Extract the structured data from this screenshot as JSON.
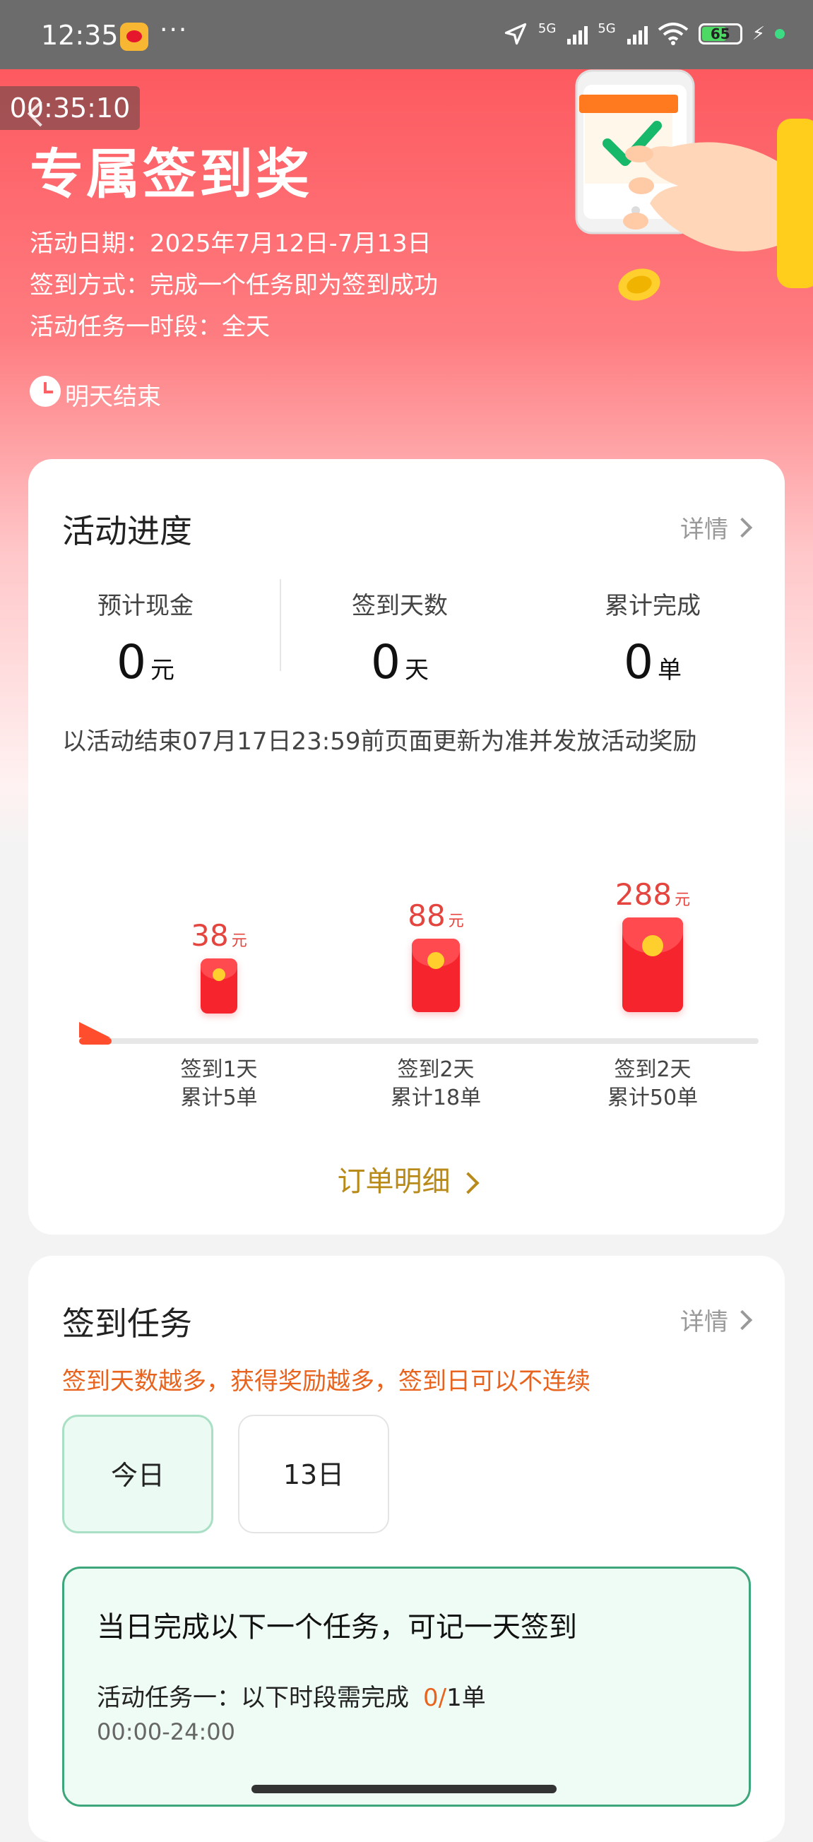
{
  "status_bar": {
    "time": "12:35",
    "more": "···",
    "signal1_label": "5G",
    "signal2_label": "5G",
    "battery_level": "65",
    "battery_percent": 65,
    "colors": {
      "background": "#6c6c6c",
      "battery_fill": "#4cd964"
    }
  },
  "timer": "00:35:10",
  "hero": {
    "title": "专属签到奖",
    "date_line": "活动日期：2025年7月12日-7月13日",
    "method_line": "签到方式：完成一个任务即为签到成功",
    "slot_line": "活动任务一时段：全天",
    "ends_label": "明天结束",
    "colors": {
      "gradient_top": "#fd5a60",
      "gradient_bottom": "#fff2f2"
    }
  },
  "progress_card": {
    "title": "活动进度",
    "detail_label": "详情",
    "stats": [
      {
        "label": "预计现金",
        "value": "0",
        "unit": "元"
      },
      {
        "label": "签到天数",
        "value": "0",
        "unit": "天"
      },
      {
        "label": "累计完成",
        "value": "0",
        "unit": "单"
      }
    ],
    "notice": "以活动结束07月17日23:59前页面更新为准并发放活动奖励",
    "milestones": [
      {
        "amount": "38",
        "unit": "元",
        "caption_line1": "签到1天",
        "caption_line2": "累计5单"
      },
      {
        "amount": "88",
        "unit": "元",
        "caption_line1": "签到2天",
        "caption_line2": "累计18单"
      },
      {
        "amount": "288",
        "unit": "元",
        "caption_line1": "签到2天",
        "caption_line2": "累计50单"
      }
    ],
    "order_link": "订单明细",
    "colors": {
      "amount": "#e5453f",
      "envelope": "#f5242d",
      "seal": "#ffcf2e",
      "order_link": "#b88a1a"
    }
  },
  "task_card": {
    "title": "签到任务",
    "detail_label": "详情",
    "subtitle": "签到天数越多，获得奖励越多，签到日可以不连续",
    "tabs": [
      {
        "label": "今日",
        "active": true
      },
      {
        "label": "13日",
        "active": false
      }
    ],
    "task_head": "当日完成以下一个任务，可记一天签到",
    "task_label": "活动任务一：以下时段需完成",
    "task_done": "0/",
    "task_total": "1单",
    "task_time": "00:00-24:00",
    "colors": {
      "subtitle": "#e8641e",
      "task_border": "#3da67a",
      "task_bg": "#effcf5"
    }
  }
}
